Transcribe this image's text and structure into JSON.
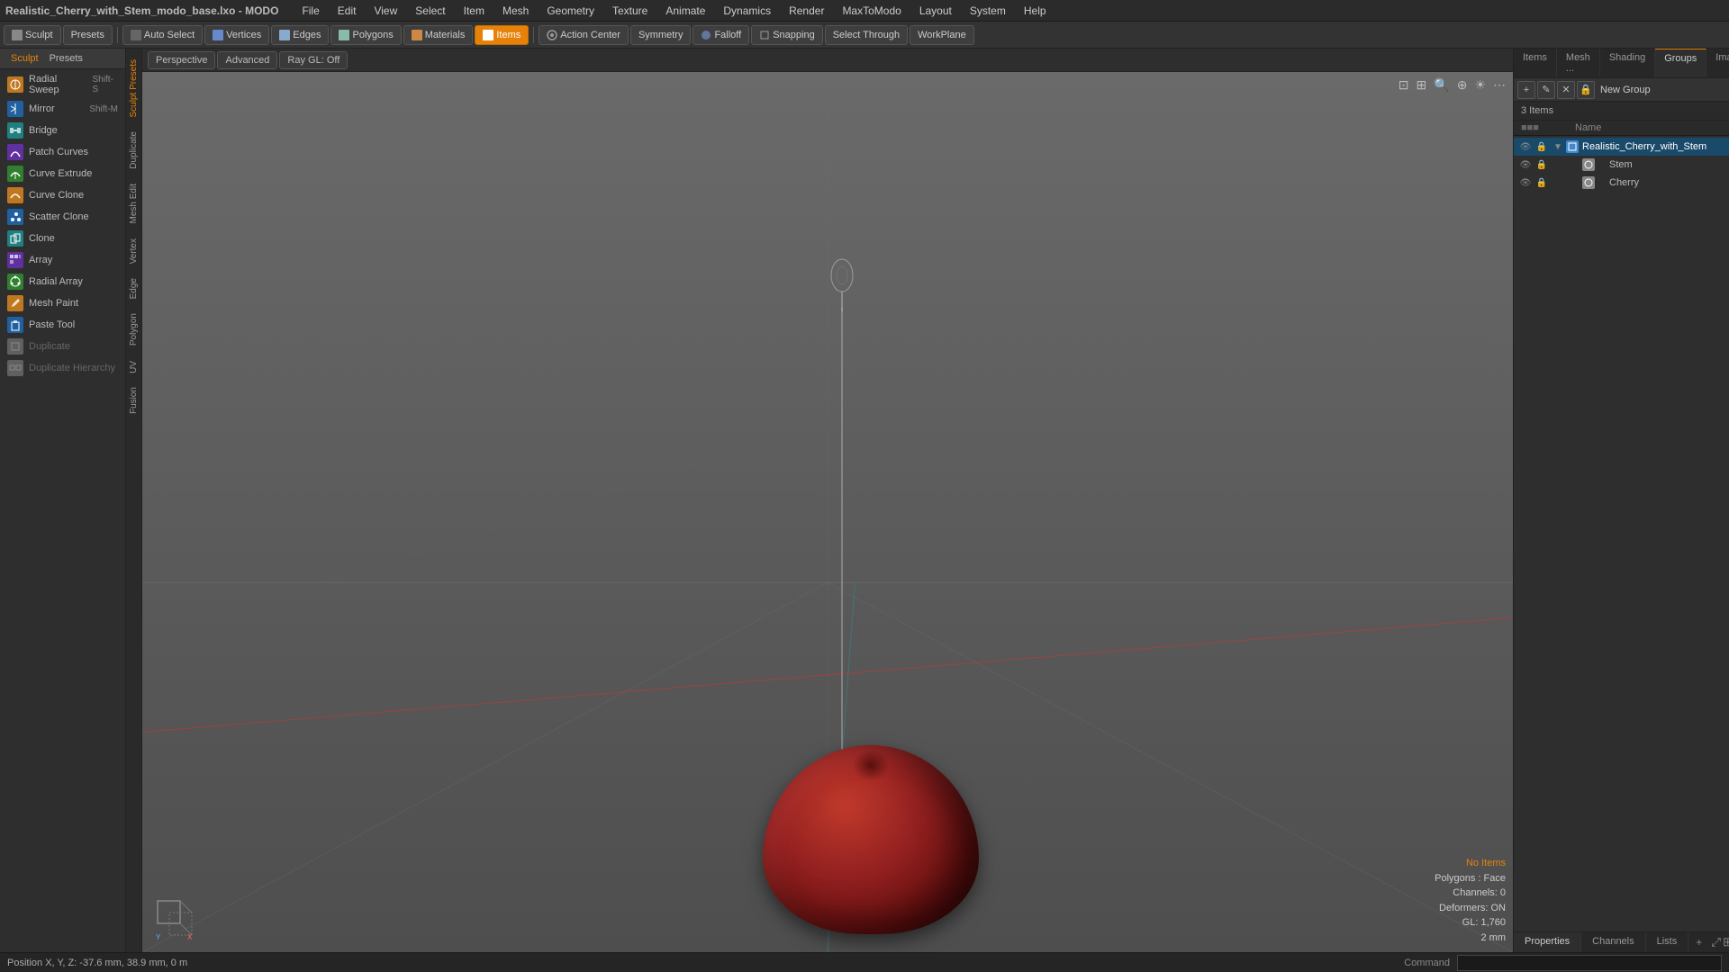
{
  "app": {
    "title": "Realistic_Cherry_with_Stem_modo_base.lxo - MODO"
  },
  "menubar": {
    "items": [
      "File",
      "Edit",
      "View",
      "Select",
      "Item",
      "Mesh",
      "Geometry",
      "Texture",
      "Animate",
      "Dynamics",
      "Render",
      "MaxToModo",
      "Layout",
      "System",
      "Help"
    ]
  },
  "toolbar": {
    "sculpt_label": "Sculpt",
    "presets_label": "Presets",
    "auto_select_label": "Auto Select",
    "vertices_label": "Vertices",
    "edges_label": "Edges",
    "polygons_label": "Polygons",
    "materials_label": "Materials",
    "items_label": "Items",
    "action_center_label": "Action Center",
    "symmetry_label": "Symmetry",
    "falloff_label": "Falloff",
    "snapping_label": "Snapping",
    "select_through_label": "Select Through",
    "workplane_label": "WorkPlane"
  },
  "left_panel": {
    "header": {
      "sculpt_label": "Sculpt",
      "presets_label": "Presets"
    },
    "tools": [
      {
        "id": "radial-sweep",
        "label": "Radial Sweep",
        "shortcut": "Shift-S",
        "icon": "orange"
      },
      {
        "id": "mirror",
        "label": "Mirror",
        "shortcut": "Shift-M",
        "icon": "blue"
      },
      {
        "id": "bridge",
        "label": "Bridge",
        "shortcut": "",
        "icon": "teal"
      },
      {
        "id": "patch-curves",
        "label": "Patch Curves",
        "shortcut": "",
        "icon": "purple"
      },
      {
        "id": "curve-extrude",
        "label": "Curve Extrude",
        "shortcut": "",
        "icon": "green"
      },
      {
        "id": "curve-clone",
        "label": "Curve Clone",
        "shortcut": "",
        "icon": "orange"
      },
      {
        "id": "scatter-clone",
        "label": "Scatter Clone",
        "shortcut": "",
        "icon": "blue"
      },
      {
        "id": "clone",
        "label": "Clone",
        "shortcut": "",
        "icon": "teal"
      },
      {
        "id": "array",
        "label": "Array",
        "shortcut": "",
        "icon": "purple"
      },
      {
        "id": "radial-array",
        "label": "Radial Array",
        "shortcut": "",
        "icon": "green"
      },
      {
        "id": "mesh-paint",
        "label": "Mesh Paint",
        "shortcut": "",
        "icon": "orange"
      },
      {
        "id": "paste-tool",
        "label": "Paste Tool",
        "shortcut": "",
        "icon": "blue"
      },
      {
        "id": "duplicate",
        "label": "Duplicate",
        "shortcut": "",
        "icon": "gray",
        "disabled": true
      },
      {
        "id": "duplicate-hierarchy",
        "label": "Duplicate Hierarchy",
        "shortcut": "",
        "icon": "gray",
        "disabled": true
      }
    ]
  },
  "side_tabs": [
    "Sculpt Presets",
    "Duplicate",
    "Mesh Edit",
    "Vertex",
    "Edge",
    "Polygon",
    "UV",
    "Fusion"
  ],
  "viewport": {
    "buttons": [
      "Perspective",
      "Advanced",
      "Ray GL: Off"
    ],
    "info": {
      "no_items": "No Items",
      "polygons": "Polygons : Face",
      "channels": "Channels: 0",
      "deformers": "Deformers: ON",
      "gl": "GL: 1,760",
      "mm": "2 mm"
    }
  },
  "right_panel": {
    "tabs": [
      "Items",
      "Mesh ...",
      "Shading",
      "Groups",
      "Images"
    ],
    "new_group_label": "New Group",
    "items_count": "3 Items",
    "col_header": "Name",
    "scene_items": [
      {
        "id": "root",
        "label": "Realistic_Cherry_with_Stem",
        "level": 0,
        "expanded": true,
        "type": "group"
      },
      {
        "id": "stem",
        "label": "Stem",
        "level": 1,
        "type": "mesh"
      },
      {
        "id": "cherry",
        "label": "Cherry",
        "level": 1,
        "type": "mesh"
      }
    ],
    "active_tab": "Groups"
  },
  "bottom_right_tabs": [
    "Properties",
    "Channels",
    "Lists",
    "add"
  ],
  "statusbar": {
    "position": "Position X, Y, Z:  -37.6 mm, 38.9 mm, 0 m",
    "command_label": "Command"
  }
}
